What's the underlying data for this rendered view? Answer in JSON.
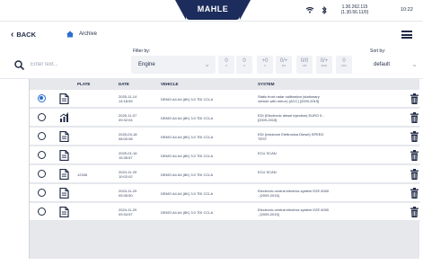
{
  "topbar": {
    "brand": "MAHLE",
    "ip": "1.30.262.115\n(1.30.56.11/0)",
    "time": "10:22"
  },
  "nav": {
    "back_label": "BACK",
    "breadcrumb": "Archive"
  },
  "filters": {
    "search_placeholder": "Enter text...",
    "filter_label": "Filter by:",
    "filter_value": "Engine",
    "filter_buttons": [
      {
        "glyph": "0",
        "label": "0"
      },
      {
        "glyph": "0",
        "label": "0"
      },
      {
        "glyph": "+0",
        "label": "0"
      },
      {
        "glyph": "0/+",
        "label": "DS"
      },
      {
        "glyph": "0/0",
        "label": "HM"
      },
      {
        "glyph": "0/+",
        "label": "MAN"
      },
      {
        "glyph": "0",
        "label": "ARC"
      }
    ],
    "sort_label": "Sort by:",
    "sort_value": "default"
  },
  "table": {
    "headers": {
      "plate": "PLATE",
      "date": "DATE",
      "vehicle": "VEHICLE",
      "system": "SYSTEM"
    },
    "rows": [
      {
        "selected": true,
        "type": "document",
        "plate": "",
        "date": "2025-11-14\n14:18:59",
        "vehicle": "DEMO A4 A4 (8K) 3.0 TDI CCLA",
        "system": "Static front radar calibration (stationary\nvehicle with mirror) (ACC) [2009-2015]"
      },
      {
        "selected": false,
        "type": "chart",
        "plate": "",
        "date": "2025-11-07\n09:32:04",
        "vehicle": "DEMO A4 A4 (8K) 3.0 TDI CCLA",
        "system": "EDI (Electronic diesel injection) EURO 5 -\n[2009-2015]"
      },
      {
        "selected": false,
        "type": "document",
        "plate": "",
        "date": "2025-03-18\n08:00:08",
        "vehicle": "DEMO A4 A4 (8K) 3.0 TDI CCLA",
        "system": "EDI (Iniezione Elettronica Diesel) SPEED\nTEST"
      },
      {
        "selected": false,
        "type": "document",
        "plate": "",
        "date": "2025-01-16\n15:35:57",
        "vehicle": "DEMO A4 A4 (8K) 3.0 TDI CCLA",
        "system": "ECU SCAN"
      },
      {
        "selected": false,
        "type": "document",
        "plate": "12345",
        "date": "2024-11-20\n10:02:02",
        "vehicle": "DEMO A4 A4 (8K) 3.0 TDI CCLA",
        "system": "ECU SCAN"
      },
      {
        "selected": false,
        "type": "document",
        "plate": "",
        "date": "2024-11-20\n09:35:50",
        "vehicle": "DEMO A4 A4 (8K) 3.0 TDI CCLA",
        "system": "Electronic central electrics system EZE 6000\n- [2009-2015]"
      },
      {
        "selected": false,
        "type": "document",
        "plate": "",
        "date": "2024-11-20\n09:34:57",
        "vehicle": "DEMO A4 A4 (8K) 3.0 TDI CCLA",
        "system": "Electronic central electrics system EZE 6000\n- [2009-2015]"
      }
    ]
  },
  "colors": {
    "brand": "#1c2c5c",
    "accent": "#2d6fcf",
    "text": "#1f2a44"
  }
}
